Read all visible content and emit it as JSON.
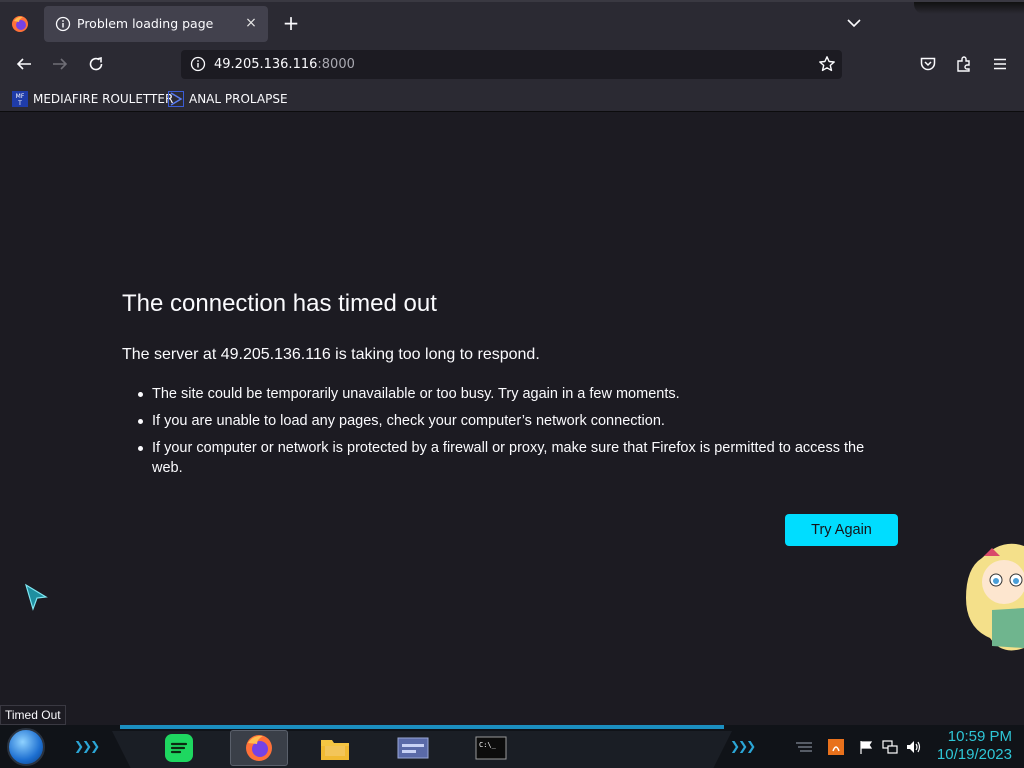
{
  "browser": {
    "tab": {
      "title": "Problem loading page",
      "close": "×"
    },
    "new_tab": "+",
    "url": {
      "host": "49.205.136.116",
      "port": ":8000"
    },
    "bookmarks": [
      {
        "label": "MEDIAFIRE ROULETTER",
        "icon": "mediafire-icon"
      },
      {
        "label": "ANAL PROLAPSE",
        "icon": "sigma-icon"
      }
    ]
  },
  "error_page": {
    "title": "The connection has timed out",
    "short_desc": "The server at 49.205.136.116 is taking too long to respond.",
    "items": [
      "The site could be temporarily unavailable or too busy. Try again in a few moments.",
      "If you are unable to load any pages, check your computer’s network connection.",
      "If your computer or network is protected by a firewall or proxy, make sure that Firefox is permitted to access the web."
    ],
    "button": "Try Again"
  },
  "status_bar": {
    "text": "Timed Out"
  },
  "taskbar": {
    "chevrons_left": "❯❯❯",
    "chevrons_right": "❯❯❯",
    "apps": [
      "spotify-icon",
      "firefox-icon",
      "file-explorer-icon",
      "control-panel-icon",
      "command-prompt-icon"
    ],
    "time": "10:59 PM",
    "date": "10/19/2023"
  },
  "colors": {
    "accent": "#00ddff",
    "taskbar_accent": "#2ec6d6",
    "background": "#1c1b22"
  }
}
